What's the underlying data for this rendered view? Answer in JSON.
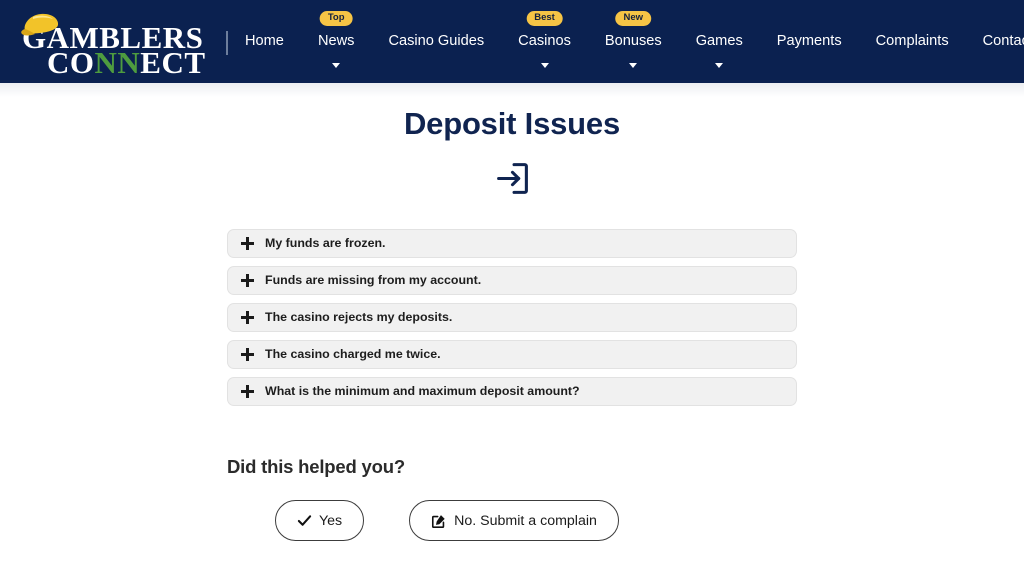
{
  "header": {
    "logo": {
      "line1": "GAMBLERS",
      "line2_pre": "CO",
      "line2_mid": "NN",
      "line2_post": "ECT",
      "cap_color": "#f2c329",
      "accent_green": "#4e9c3f",
      "bar_color": "#0b2150"
    },
    "nav": [
      {
        "label": "Home",
        "badge": null,
        "caret": false
      },
      {
        "label": "News",
        "badge": "Top",
        "caret": true
      },
      {
        "label": "Casino Guides",
        "badge": null,
        "caret": false
      },
      {
        "label": "Casinos",
        "badge": "Best",
        "caret": true
      },
      {
        "label": "Bonuses",
        "badge": "New",
        "caret": true
      },
      {
        "label": "Games",
        "badge": null,
        "caret": true
      },
      {
        "label": "Payments",
        "badge": null,
        "caret": false
      },
      {
        "label": "Complaints",
        "badge": null,
        "caret": false
      },
      {
        "label": "Contact",
        "badge": null,
        "caret": false
      }
    ],
    "search_icon": "search-icon",
    "badge_color": "#f6c445"
  },
  "main": {
    "title": "Deposit Issues",
    "title_icon": "sign-in-icon",
    "title_color": "#102450",
    "accordion": [
      {
        "label": "My funds are frozen."
      },
      {
        "label": "Funds are missing from my account."
      },
      {
        "label": "The casino rejects my deposits."
      },
      {
        "label": "The casino charged me twice."
      },
      {
        "label": "What is the minimum and maximum deposit amount?"
      }
    ],
    "feedback": {
      "question": "Did this helped you?",
      "yes_label": "Yes",
      "yes_icon": "check-icon",
      "no_label": "No. Submit a complain",
      "no_icon": "edit-pencil-icon"
    }
  }
}
